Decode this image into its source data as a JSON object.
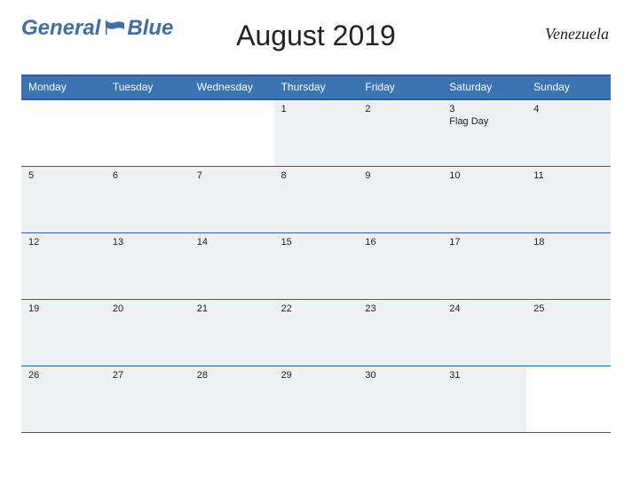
{
  "brand": {
    "word1": "General",
    "word2": "Blue"
  },
  "title": "August 2019",
  "country": "Venezuela",
  "daysOfWeek": [
    "Monday",
    "Tuesday",
    "Wednesday",
    "Thursday",
    "Friday",
    "Saturday",
    "Sunday"
  ],
  "colors": {
    "brandBlue": "#3f6fa6",
    "headerBg": "#3a74b3",
    "borderBlue": "#2d5e94",
    "cellBg": "#eef1f3"
  },
  "weeks": [
    [
      {
        "n": "",
        "event": ""
      },
      {
        "n": "",
        "event": ""
      },
      {
        "n": "",
        "event": ""
      },
      {
        "n": "1",
        "event": ""
      },
      {
        "n": "2",
        "event": ""
      },
      {
        "n": "3",
        "event": "Flag Day"
      },
      {
        "n": "4",
        "event": ""
      }
    ],
    [
      {
        "n": "5",
        "event": ""
      },
      {
        "n": "6",
        "event": ""
      },
      {
        "n": "7",
        "event": ""
      },
      {
        "n": "8",
        "event": ""
      },
      {
        "n": "9",
        "event": ""
      },
      {
        "n": "10",
        "event": ""
      },
      {
        "n": "11",
        "event": ""
      }
    ],
    [
      {
        "n": "12",
        "event": ""
      },
      {
        "n": "13",
        "event": ""
      },
      {
        "n": "14",
        "event": ""
      },
      {
        "n": "15",
        "event": ""
      },
      {
        "n": "16",
        "event": ""
      },
      {
        "n": "17",
        "event": ""
      },
      {
        "n": "18",
        "event": ""
      }
    ],
    [
      {
        "n": "19",
        "event": ""
      },
      {
        "n": "20",
        "event": ""
      },
      {
        "n": "21",
        "event": ""
      },
      {
        "n": "22",
        "event": ""
      },
      {
        "n": "23",
        "event": ""
      },
      {
        "n": "24",
        "event": ""
      },
      {
        "n": "25",
        "event": ""
      }
    ],
    [
      {
        "n": "26",
        "event": ""
      },
      {
        "n": "27",
        "event": ""
      },
      {
        "n": "28",
        "event": ""
      },
      {
        "n": "29",
        "event": ""
      },
      {
        "n": "30",
        "event": ""
      },
      {
        "n": "31",
        "event": ""
      },
      {
        "n": "",
        "event": ""
      }
    ]
  ]
}
